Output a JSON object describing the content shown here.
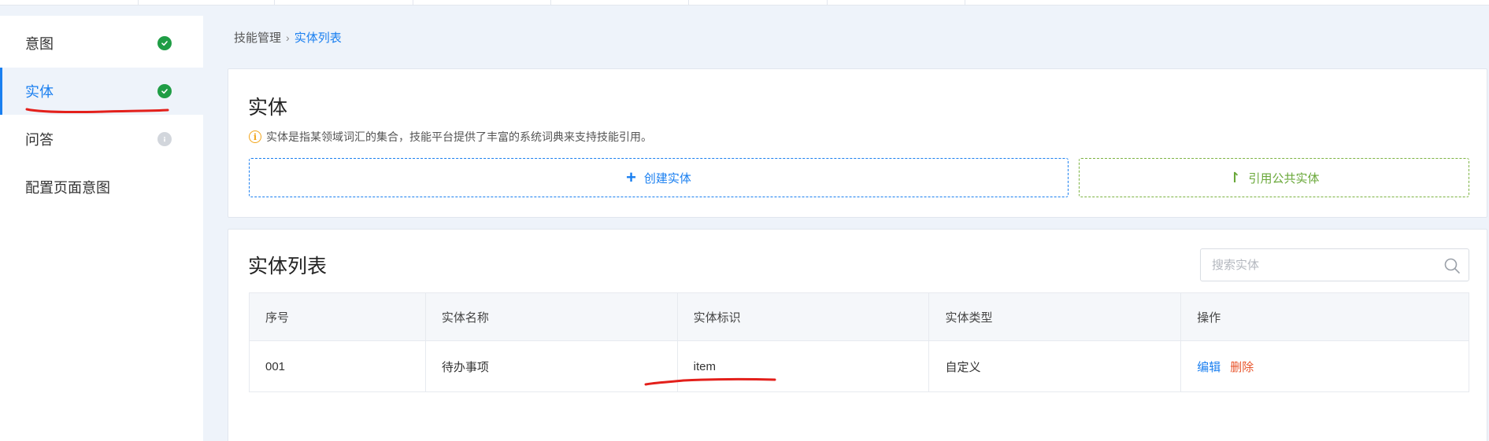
{
  "sidebar": {
    "items": [
      {
        "label": "意图",
        "status": "complete"
      },
      {
        "label": "实体",
        "status": "complete",
        "active": true
      },
      {
        "label": "问答",
        "status": "pending"
      },
      {
        "label": "配置页面意图"
      }
    ]
  },
  "breadcrumb": {
    "parent": "技能管理",
    "current": "实体列表"
  },
  "entity_card": {
    "title": "实体",
    "notice": "实体是指某领域词汇的集合，技能平台提供了丰富的系统词典来支持技能引用。",
    "create_button": "创建实体",
    "reference_button": "引用公共实体"
  },
  "list_card": {
    "title": "实体列表",
    "search_placeholder": "搜索实体",
    "columns": [
      "序号",
      "实体名称",
      "实体标识",
      "实体类型",
      "操作"
    ],
    "rows": [
      {
        "index": "001",
        "name": "待办事项",
        "identifier": "item",
        "type": "自定义",
        "actions": [
          "编辑",
          "删除"
        ]
      }
    ]
  },
  "colors": {
    "accent": "#1a7ff0",
    "success": "#1f9d45",
    "reference_green": "#6aa83a",
    "danger": "#e8542b",
    "annotation_red": "#e3201b"
  },
  "icons": {
    "status_complete": "check-circle-icon",
    "status_pending": "info-circle-icon",
    "notice": "info-icon",
    "create": "plus-icon",
    "reference": "reference-icon",
    "search": "search-icon"
  }
}
